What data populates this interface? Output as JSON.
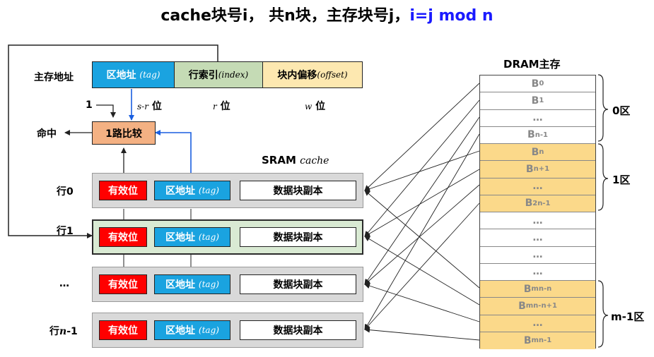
{
  "title": {
    "prefix": "cache块号i， 共n块，主存块号j，",
    "formula": "i=j mod n"
  },
  "address": {
    "label": "主存地址",
    "tag": "区地址",
    "tag_it": "(tag)",
    "index": "行索引",
    "index_it": "(index)",
    "offset": "块内偏移",
    "offset_it": "(offset)",
    "one": "1",
    "sr_it": "s-r",
    "sr_unit": "位",
    "r_it": "r",
    "r_unit": "位",
    "w_it": "w",
    "w_unit": "位"
  },
  "compare": {
    "label": "1路比较",
    "hit": "命中"
  },
  "cache": {
    "title": "SRAM",
    "title_it": "cache",
    "rows": [
      {
        "label": "行0",
        "valid": "有效位",
        "tag": "区地址",
        "tag_it": "(tag)",
        "data": "数据块副本"
      },
      {
        "label": "行1",
        "valid": "有效位",
        "tag": "区地址",
        "tag_it": "(tag)",
        "data": "数据块副本"
      },
      {
        "label": "…",
        "valid": "有效位",
        "tag": "区地址",
        "tag_it": "(tag)",
        "data": "数据块副本"
      },
      {
        "label_pre": "行",
        "label_it": "n",
        "label_post": "-1",
        "valid": "有效位",
        "tag": "区地址",
        "tag_it": "(tag)",
        "data": "数据块副本"
      }
    ]
  },
  "dram": {
    "title": "DRAM主存",
    "blocks": [
      {
        "base": "B",
        "sub": "0"
      },
      {
        "base": "B",
        "sub": "1"
      },
      {
        "base": "…",
        "sub": ""
      },
      {
        "base": "B",
        "sub": "n-1"
      },
      {
        "base": "B",
        "sub": "n"
      },
      {
        "base": "B",
        "sub": "n+1"
      },
      {
        "base": "…",
        "sub": ""
      },
      {
        "base": "B",
        "sub": "2n-1"
      },
      {
        "base": "…",
        "sub": ""
      },
      {
        "base": "…",
        "sub": ""
      },
      {
        "base": "…",
        "sub": ""
      },
      {
        "base": "…",
        "sub": ""
      },
      {
        "base": "B",
        "sub": "mn-n"
      },
      {
        "base": "B",
        "sub": "mn-n+1"
      },
      {
        "base": "…",
        "sub": ""
      },
      {
        "base": "B",
        "sub": "mn-1"
      }
    ],
    "zones": [
      "0区",
      "1区",
      "m-1区"
    ]
  }
}
